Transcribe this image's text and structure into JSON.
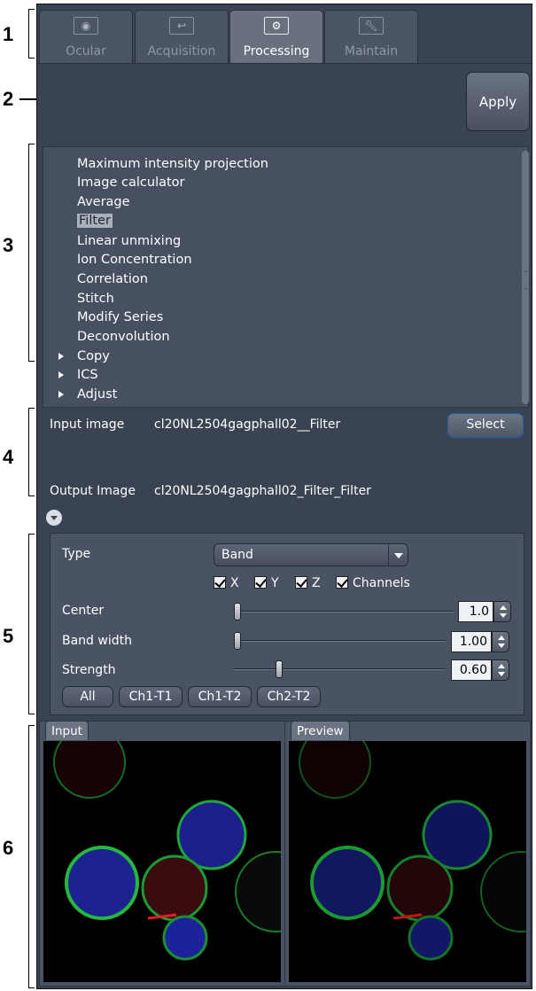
{
  "callouts": [
    "1",
    "2",
    "3",
    "4",
    "5",
    "6"
  ],
  "tabs": [
    {
      "label": "Ocular",
      "icon": "eye-icon",
      "selected": false
    },
    {
      "label": "Acquisition",
      "icon": "acquisition-icon",
      "selected": false
    },
    {
      "label": "Processing",
      "icon": "gear-icon",
      "selected": true
    },
    {
      "label": "Maintain",
      "icon": "wrench-icon",
      "selected": false
    }
  ],
  "apply_label": "Apply",
  "method_list": [
    {
      "label": "Maximum intensity projection",
      "expandable": false,
      "selected": false
    },
    {
      "label": "Image calculator",
      "expandable": false,
      "selected": false
    },
    {
      "label": "Average",
      "expandable": false,
      "selected": false
    },
    {
      "label": "Filter",
      "expandable": false,
      "selected": true
    },
    {
      "label": "Linear unmixing",
      "expandable": false,
      "selected": false
    },
    {
      "label": "Ion Concentration",
      "expandable": false,
      "selected": false
    },
    {
      "label": "Correlation",
      "expandable": false,
      "selected": false
    },
    {
      "label": "Stitch",
      "expandable": false,
      "selected": false
    },
    {
      "label": "Modify Series",
      "expandable": false,
      "selected": false
    },
    {
      "label": "Deconvolution",
      "expandable": false,
      "selected": false
    },
    {
      "label": "Copy",
      "expandable": true,
      "selected": false
    },
    {
      "label": "ICS",
      "expandable": true,
      "selected": false
    },
    {
      "label": "Adjust",
      "expandable": true,
      "selected": false
    }
  ],
  "io": {
    "input_label": "Input image",
    "input_value": "cl20NL2504gagphall02__Filter",
    "select_label": "Select",
    "output_label": "Output Image",
    "output_value": "cl20NL2504gagphall02_Filter_Filter"
  },
  "params": {
    "type_label": "Type",
    "type_value": "Band",
    "checkboxes": [
      {
        "label": "X",
        "checked": true
      },
      {
        "label": "Y",
        "checked": true
      },
      {
        "label": "Z",
        "checked": true
      },
      {
        "label": "Channels",
        "checked": true
      }
    ],
    "center": {
      "label": "Center",
      "value": "1.0"
    },
    "band_width": {
      "label": "Band width",
      "value": "1.00"
    },
    "strength": {
      "label": "Strength",
      "value": "0.60"
    },
    "channel_buttons": [
      "All",
      "Ch1-T1",
      "Ch1-T2",
      "Ch2-T2"
    ]
  },
  "images": {
    "input_label": "Input",
    "preview_label": "Preview"
  },
  "colors": {
    "panel": "#3a4352",
    "list_bg": "#465061",
    "selected_tab": "#69717f",
    "select_border": "#1f5fae"
  }
}
